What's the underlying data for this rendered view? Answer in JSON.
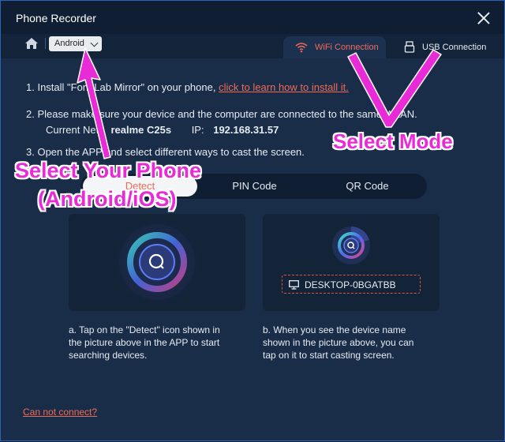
{
  "window": {
    "title": "Phone Recorder"
  },
  "toolbar": {
    "device_select": "Android"
  },
  "tabs": [
    {
      "label": "WiFi Connection",
      "active": true
    },
    {
      "label": "USB Connection",
      "active": false
    }
  ],
  "steps": {
    "step1_prefix": "1. Install \"FoneLab Mirror\" on your phone, ",
    "step1_link": "click to learn how to install it.",
    "step2": "2. Please make sure your device and the computer are connected to the same WLAN.",
    "current_net_label": "Current Net:",
    "current_net_value": "realme C25s",
    "ip_label": "IP:",
    "ip_value": "192.168.31.57",
    "step3": "3. Open the APP and select different ways to cast the screen."
  },
  "segments": [
    {
      "label": "Detect",
      "active": true
    },
    {
      "label": "PIN Code",
      "active": false
    },
    {
      "label": "QR Code",
      "active": false
    }
  ],
  "cards": {
    "device_name": "DESKTOP-0BGATBB",
    "desc_a": [
      "a. Tap on the \"Detect\" icon shown in",
      "the picture above in the APP to start",
      "searching devices."
    ],
    "desc_b": [
      "b. When you see the device name",
      "shown in the picture above, you can",
      "tap on it to start casting screen."
    ]
  },
  "footer": {
    "cannot_connect": "Can not connect?"
  },
  "annotations": {
    "select_mode": "Select Mode",
    "select_phone_line1": "Select Your Phone",
    "select_phone_line2": "(Android/iOS)"
  },
  "colors": {
    "accent": "#f06a55",
    "annotation": "#e82bd6",
    "background": "#1a2d48"
  }
}
